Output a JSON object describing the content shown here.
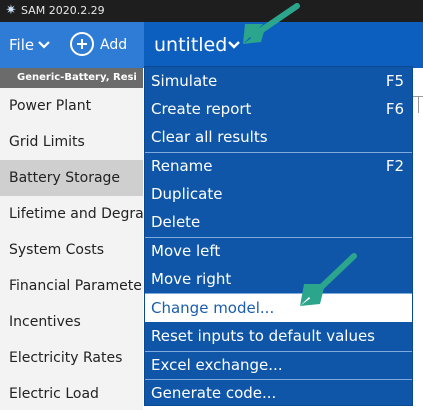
{
  "titlebar": {
    "title": "SAM 2020.2.29",
    "icon": "sun-icon"
  },
  "toolbar": {
    "file_label": "File",
    "add_label": "Add",
    "case_name": "untitled"
  },
  "config_bar": {
    "text": "Generic-Battery, Resi"
  },
  "sidebar": {
    "items": [
      {
        "label": "Power Plant",
        "selected": false
      },
      {
        "label": "Grid Limits",
        "selected": false
      },
      {
        "label": "Battery Storage",
        "selected": true
      },
      {
        "label": "Lifetime and Degradation",
        "selected": false
      },
      {
        "label": "System Costs",
        "selected": false
      },
      {
        "label": "Financial Parameters",
        "selected": false
      },
      {
        "label": "Incentives",
        "selected": false
      },
      {
        "label": "Electricity Rates",
        "selected": false
      },
      {
        "label": "Electric Load",
        "selected": false
      }
    ]
  },
  "menu": {
    "items": [
      {
        "label": "Simulate",
        "shortcut": "F5"
      },
      {
        "label": "Create report",
        "shortcut": "F6"
      },
      {
        "label": "Clear all results",
        "shortcut": ""
      },
      {
        "label": "Rename",
        "shortcut": "F2"
      },
      {
        "label": "Duplicate",
        "shortcut": ""
      },
      {
        "label": "Delete",
        "shortcut": ""
      },
      {
        "label": "Move left",
        "shortcut": ""
      },
      {
        "label": "Move right",
        "shortcut": ""
      },
      {
        "label": "Change model...",
        "shortcut": "",
        "highlighted": true
      },
      {
        "label": "Reset inputs to default values",
        "shortcut": ""
      },
      {
        "label": "Excel exchange...",
        "shortcut": ""
      },
      {
        "label": "Generate code...",
        "shortcut": ""
      }
    ]
  },
  "colors": {
    "toolbar_blue": "#2f7cd6",
    "menu_blue": "#0f56a8",
    "arrow_green": "#2ca58d"
  }
}
